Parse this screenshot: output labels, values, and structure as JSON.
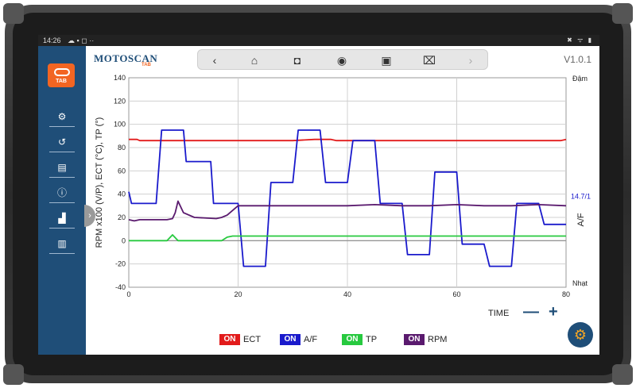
{
  "status_bar": {
    "time": "14:26",
    "icons_left": "☁ ▪ ◻ ··",
    "icons_right": "✖ ᯤ ▮"
  },
  "app": {
    "brand": "MOTOSCAN",
    "brand_sub": "TAB",
    "version": "V1.0.1",
    "logo_label": "TAB"
  },
  "toolbar": {
    "back_icon": "‹",
    "home_icon": "⌂",
    "camera_icon": "◘",
    "record_icon": "◉",
    "save_icon": "▣",
    "delete_icon": "⌧",
    "forward_icon": "›"
  },
  "sidebar": {
    "items": [
      {
        "name": "parameters-icon",
        "glyph": "⚙"
      },
      {
        "name": "history-icon",
        "glyph": "↺"
      },
      {
        "name": "clipboard-icon",
        "glyph": "▤"
      },
      {
        "name": "info-icon",
        "glyph": "ⓘ"
      },
      {
        "name": "factory-icon",
        "glyph": "▟"
      },
      {
        "name": "bank-icon",
        "glyph": "▥"
      }
    ],
    "expand_icon": "›"
  },
  "chart_data": {
    "type": "line",
    "ylabel": "RPM x100 (V/P), ECT (°C), TP (°)",
    "ylabel_right": "A/F",
    "right_top": "Đậm",
    "right_bottom": "Nhạt",
    "right_ref_label": "14.7/1",
    "right_ref_y": 38,
    "xlabel": "TIME",
    "xlim": [
      0,
      80
    ],
    "ylim": [
      -40,
      140
    ],
    "xticks": [
      0,
      20,
      40,
      60,
      80
    ],
    "yticks": [
      -40,
      -20,
      0,
      20,
      40,
      60,
      80,
      100,
      120,
      140
    ],
    "grid": true,
    "series": [
      {
        "name": "ECT",
        "color": "#e21b1b",
        "x": [
          0,
          1.5,
          2,
          20,
          25,
          27,
          28,
          30,
          34,
          35,
          37,
          38,
          56,
          57,
          78,
          79,
          80
        ],
        "y": [
          87,
          87,
          86,
          86,
          86,
          86,
          86,
          86,
          87,
          87,
          87,
          86,
          86,
          86,
          86,
          86,
          87
        ]
      },
      {
        "name": "A/F",
        "color": "#1a1acc",
        "x": [
          0,
          0.5,
          5,
          6,
          10,
          10.5,
          15,
          15.5,
          20,
          21,
          25,
          26,
          30,
          31,
          35,
          36,
          40,
          41,
          45,
          46,
          50,
          51,
          55,
          56,
          60,
          61,
          65,
          66,
          70,
          71,
          75,
          76,
          80
        ],
        "y": [
          42,
          32,
          32,
          95,
          95,
          68,
          68,
          32,
          32,
          -22,
          -22,
          50,
          50,
          95,
          95,
          50,
          50,
          86,
          86,
          32,
          32,
          -12,
          -12,
          59,
          59,
          -3,
          -3,
          -22,
          -22,
          32,
          32,
          14,
          14
        ]
      },
      {
        "name": "TP",
        "color": "#27c93f",
        "x": [
          0,
          7,
          8,
          9,
          17,
          18,
          19,
          80
        ],
        "y": [
          0,
          0,
          5,
          0,
          0,
          3,
          4,
          4
        ]
      },
      {
        "name": "RPM",
        "color": "#5a1a6e",
        "x": [
          0,
          1,
          2,
          5,
          7,
          8,
          8.5,
          9,
          10,
          12,
          16,
          17,
          18,
          19,
          20,
          25,
          30,
          35,
          40,
          45,
          50,
          55,
          60,
          65,
          70,
          75,
          80
        ],
        "y": [
          18,
          17,
          18,
          18,
          18,
          19,
          24,
          34,
          24,
          20,
          19,
          20,
          22,
          26,
          30,
          30,
          30,
          30,
          30,
          31,
          30,
          30,
          31,
          30,
          30,
          31,
          30
        ]
      }
    ]
  },
  "legend": [
    {
      "badge": "ON",
      "label": "ECT",
      "color": "#e21b1b"
    },
    {
      "badge": "ON",
      "label": "A/F",
      "color": "#1a1acc"
    },
    {
      "badge": "ON",
      "label": "TP",
      "color": "#27c93f"
    },
    {
      "badge": "ON",
      "label": "RPM",
      "color": "#5a1a6e"
    }
  ],
  "controls": {
    "zoom_out": "—",
    "zoom_in": "+",
    "time_label": "TIME",
    "settings_icon": "⚙"
  }
}
